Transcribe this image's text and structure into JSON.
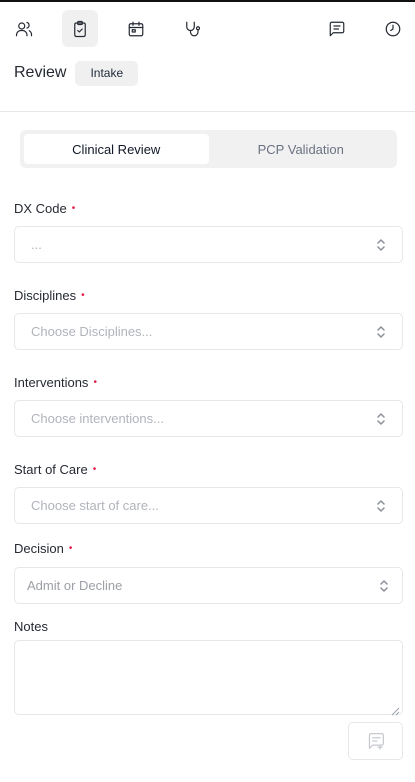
{
  "toolbar": {
    "left_icons": [
      "users-icon",
      "clipboard-check-icon",
      "calendar-icon",
      "stethoscope-icon"
    ],
    "right_icons": [
      "message-square-icon",
      "clock-icon"
    ],
    "active_icon": "clipboard-check-icon"
  },
  "header": {
    "title": "Review",
    "badge": "Intake"
  },
  "tabs": [
    {
      "label": "Clinical Review",
      "active": true
    },
    {
      "label": "PCP Validation",
      "active": false
    }
  ],
  "form": {
    "dx_code": {
      "label": "DX Code",
      "required": true,
      "placeholder": "..."
    },
    "disciplines": {
      "label": "Disciplines",
      "required": true,
      "placeholder": "Choose Disciplines..."
    },
    "interventions": {
      "label": "Interventions",
      "required": true,
      "placeholder": "Choose interventions..."
    },
    "start_of_care": {
      "label": "Start of Care",
      "required": true,
      "placeholder": "Choose start of care..."
    },
    "decision": {
      "label": "Decision",
      "required": true,
      "placeholder": "Admit or Decline"
    },
    "notes": {
      "label": "Notes",
      "value": ""
    }
  },
  "required_marker": "•",
  "colors": {
    "required": "#e11d48",
    "active_tab_bg": "#ffffff",
    "tab_bar_bg": "#f1f1f2"
  }
}
